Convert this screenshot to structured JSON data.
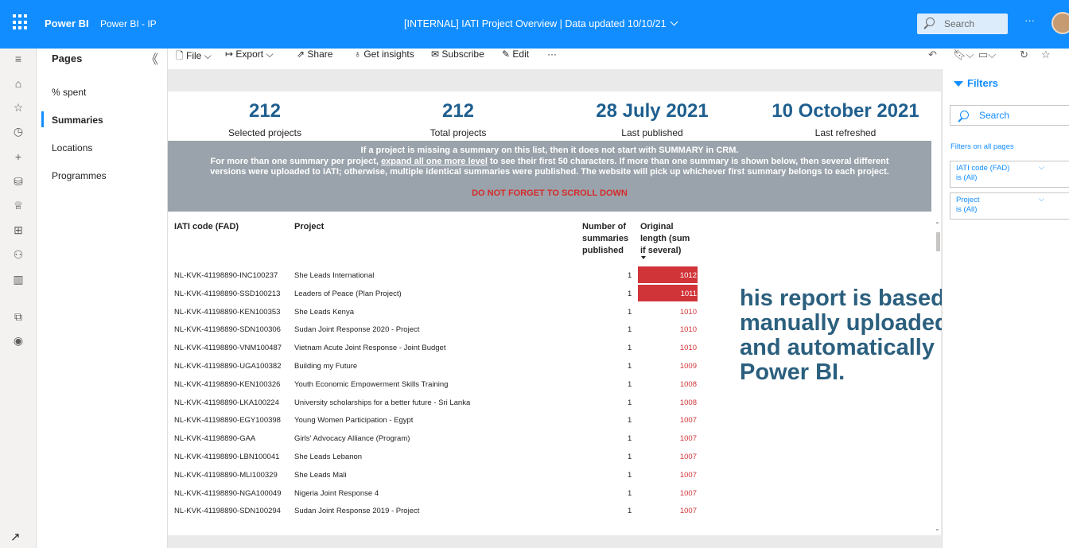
{
  "topbar": {
    "brand": "Power BI",
    "workspace": "Power BI - IP",
    "report_title": "[INTERNAL] IATI Project Overview |   Data updated 10/10/21",
    "search_placeholder": "Search",
    "more": "···"
  },
  "pages_pane": {
    "title": "Pages",
    "collapse": "《",
    "items": [
      {
        "label": "% spent"
      },
      {
        "label": "Summaries"
      },
      {
        "label": "Locations"
      },
      {
        "label": "Programmes"
      }
    ]
  },
  "toolbar": {
    "file": "File",
    "export": "Export",
    "share": "Share",
    "get_insights": "Get insights",
    "subscribe": "Subscribe",
    "edit": "Edit",
    "more": "···"
  },
  "kpis": [
    {
      "value": "212",
      "label": "Selected projects"
    },
    {
      "value": "212",
      "label": "Total projects"
    },
    {
      "value": "28 July 2021",
      "label": "Last published"
    },
    {
      "value": "10 October 2021",
      "label": "Last refreshed"
    }
  ],
  "notice": {
    "line1": "If a project is missing a summary on this list, then it does not start with SUMMARY in CRM.",
    "line2_pre": "For more than one summary per project, ",
    "line2_link": "expand all one more level",
    "line2_post": " to see their first 50 characters. If more than one summary is shown below, then several different",
    "line3": "versions were uploaded to IATI; otherwise, multiple identical summaries were published. The website will pick up whichever first summary belongs to each project.",
    "warning": "DO NOT FORGET TO SCROLL DOWN"
  },
  "table": {
    "headers": {
      "code": "IATI code (FAD)",
      "project": "Project",
      "num_l1": "Number of",
      "num_l2": "summaries",
      "num_l3": "published",
      "len_l1": "Original",
      "len_l2": "length (sum",
      "len_l3": "if several)"
    },
    "rows": [
      {
        "code": "NL-KVK-41198890-INC100237",
        "project": "She Leads International",
        "count": "1",
        "length": "1012",
        "highlight": true
      },
      {
        "code": "NL-KVK-41198890-SSD100213",
        "project": "Leaders of Peace (Plan Project)",
        "count": "1",
        "length": "1011",
        "highlight": true
      },
      {
        "code": "NL-KVK-41198890-KEN100353",
        "project": "She Leads Kenya",
        "count": "1",
        "length": "1010",
        "highlight": false
      },
      {
        "code": "NL-KVK-41198890-SDN100306",
        "project": "Sudan Joint Response 2020 - Project",
        "count": "1",
        "length": "1010",
        "highlight": false
      },
      {
        "code": "NL-KVK-41198890-VNM100487",
        "project": "Vietnam Acute Joint Response - Joint Budget",
        "count": "1",
        "length": "1010",
        "highlight": false
      },
      {
        "code": "NL-KVK-41198890-UGA100382",
        "project": "Building my Future",
        "count": "1",
        "length": "1009",
        "highlight": false
      },
      {
        "code": "NL-KVK-41198890-KEN100326",
        "project": "Youth Economic Empowerment Skills Training",
        "count": "1",
        "length": "1008",
        "highlight": false
      },
      {
        "code": "NL-KVK-41198890-LKA100224",
        "project": "University scholarships for a better future - Sri Lanka",
        "count": "1",
        "length": "1008",
        "highlight": false
      },
      {
        "code": "NL-KVK-41198890-EGY100398",
        "project": "Young Women Participation - Egypt",
        "count": "1",
        "length": "1007",
        "highlight": false
      },
      {
        "code": "NL-KVK-41198890-GAA",
        "project": "Girls' Advocacy Alliance (Program)",
        "count": "1",
        "length": "1007",
        "highlight": false
      },
      {
        "code": "NL-KVK-41198890-LBN100041",
        "project": "She Leads Lebanon",
        "count": "1",
        "length": "1007",
        "highlight": false
      },
      {
        "code": "NL-KVK-41198890-MLI100329",
        "project": "She Leads Mali",
        "count": "1",
        "length": "1007",
        "highlight": false
      },
      {
        "code": "NL-KVK-41198890-NGA100049",
        "project": "Nigeria Joint Response 4",
        "count": "1",
        "length": "1007",
        "highlight": false
      },
      {
        "code": "NL-KVK-41198890-SDN100294",
        "project": "Sudan Joint Response 2019 - Project",
        "count": "1",
        "length": "1007",
        "highlight": false
      }
    ]
  },
  "overlay": {
    "line1": "his report is based on",
    "line2": "manually uploaded to",
    "line3": "and automatically refr",
    "line4": "Power BI."
  },
  "filters": {
    "title": "Filters",
    "search_placeholder": "Search",
    "section": "Filters on all pages",
    "cards": [
      {
        "name": "IATI code (FAD)",
        "state": "is (All)"
      },
      {
        "name": "Project",
        "state": "is (All)"
      }
    ]
  },
  "colors": {
    "brand_blue": "#118dff",
    "kpi_blue": "#1f5f8f",
    "notice_gray": "#9aa3ab",
    "alert_red": "#d13438"
  }
}
